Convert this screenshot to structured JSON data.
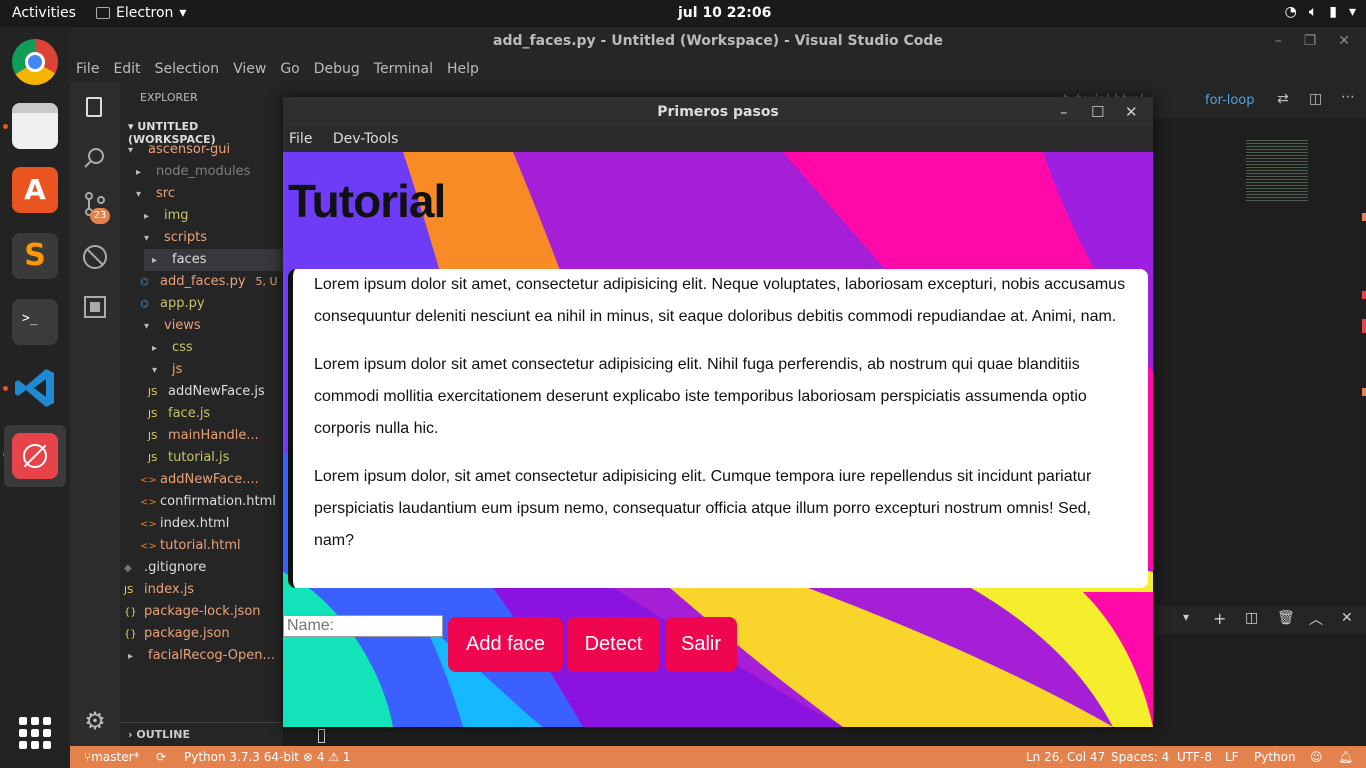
{
  "topbar": {
    "activities": "Activities",
    "app_name": "Electron",
    "clock": "jul 10  22:06"
  },
  "vscode": {
    "title": "add_faces.py - Untitled (Workspace) - Visual Studio Code",
    "menu": [
      "File",
      "Edit",
      "Selection",
      "View",
      "Go",
      "Debug",
      "Terminal",
      "Help"
    ],
    "explorer_title": "EXPLORER",
    "workspace_title": "UNTITLED (WORKSPACE)",
    "scm_badge": "23",
    "tree": [
      {
        "label": "ascensor-gui",
        "color": "#e9a27a"
      },
      {
        "label": "node_modules",
        "color": "#7f7f7f"
      },
      {
        "label": "src",
        "color": "#e9a27a"
      },
      {
        "label": "img",
        "color": "#c5c56a"
      },
      {
        "label": "scripts",
        "color": "#e9a27a"
      },
      {
        "label": "faces",
        "color": "#dddddd"
      },
      {
        "label": "add_faces.py",
        "color": "#e9a27a",
        "decoration": "5, U"
      },
      {
        "label": "app.py",
        "color": "#c5c56a"
      },
      {
        "label": "views",
        "color": "#e9a27a"
      },
      {
        "label": "css",
        "color": "#c5c56a"
      },
      {
        "label": "js",
        "color": "#e9a27a"
      },
      {
        "label": "addNewFace.js",
        "color": "#dddddd"
      },
      {
        "label": "face.js",
        "color": "#c5c56a"
      },
      {
        "label": "mainHandle...",
        "color": "#e9a27a"
      },
      {
        "label": "tutorial.js",
        "color": "#c5c56a"
      },
      {
        "label": "addNewFace....",
        "color": "#e9a27a"
      },
      {
        "label": "confirmation.html",
        "color": "#dddddd"
      },
      {
        "label": "index.html",
        "color": "#dddddd"
      },
      {
        "label": "tutorial.html",
        "color": "#e9a27a"
      },
      {
        "label": ".gitignore",
        "color": "#dddddd"
      },
      {
        "label": "index.js",
        "color": "#e9a27a"
      },
      {
        "label": "package-lock.json",
        "color": "#e9a27a"
      },
      {
        "label": "package.json",
        "color": "#e9a27a"
      },
      {
        "label": "facialRecog-Open...",
        "color": "#e9a27a"
      }
    ],
    "outline_title": "OUTLINE",
    "tab_right": "for-loop",
    "tab_html": "tutorial.html",
    "status": {
      "branch": "master*",
      "python": "Python 3.7.3 64-bit",
      "errors": "4",
      "warnings": "1",
      "position": "Ln 26, Col 47",
      "spaces": "Spaces: 4",
      "encoding": "UTF-8",
      "eol": "LF",
      "language": "Python"
    }
  },
  "electron": {
    "title": "Primeros pasos",
    "menu": [
      "File",
      "Dev-Tools"
    ],
    "heading": "Tutorial",
    "paragraphs": [
      "Lorem ipsum dolor sit amet, consectetur adipisicing elit. Neque voluptates, laboriosam excepturi, nobis accusamus consequuntur deleniti nesciunt ea nihil in minus, sit eaque doloribus debitis commodi repudiandae at. Animi, nam.",
      "Lorem ipsum dolor sit amet consectetur adipisicing elit. Nihil fuga perferendis, ab nostrum qui quae blanditiis commodi mollitia exercitationem deserunt explicabo iste temporibus laboriosam perspiciatis assumenda optio corporis nulla hic.",
      "Lorem ipsum dolor, sit amet consectetur adipisicing elit. Cumque tempora iure repellendus sit incidunt pariatur perspiciatis laudantium eum ipsum nemo, consequatur officia atque illum porro excepturi nostrum omnis! Sed, nam?"
    ],
    "name_placeholder": "Name:",
    "buttons": {
      "add_face": "Add face",
      "detect": "Detect",
      "salir": "Salir"
    },
    "accent": "#f0064f"
  }
}
